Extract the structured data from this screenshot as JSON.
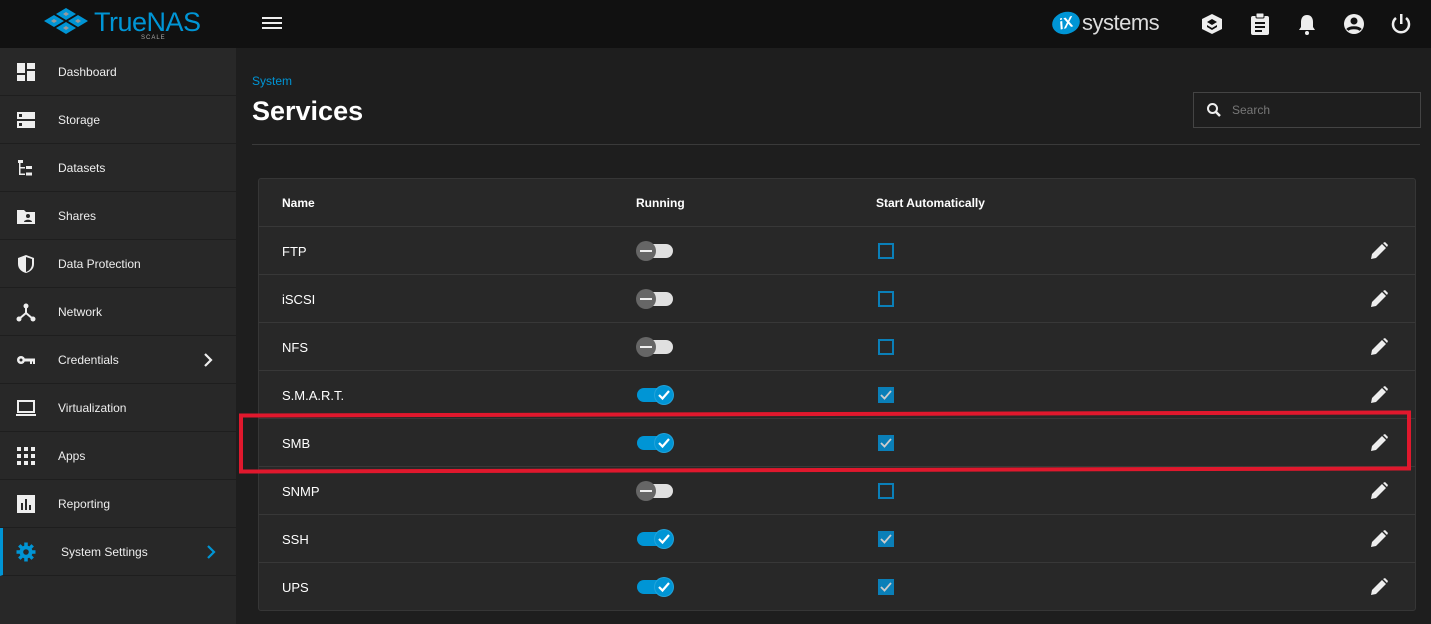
{
  "app": {
    "brand": "TrueNAS",
    "brand_sub": "SCALE",
    "vendor": "systems",
    "vendor_mark": "iX"
  },
  "topbar": {
    "icons": [
      "truecommand-icon",
      "clipboard-icon",
      "bell-icon",
      "account-icon",
      "power-icon"
    ]
  },
  "sidebar": {
    "items": [
      {
        "label": "Dashboard",
        "icon": "dashboard-icon"
      },
      {
        "label": "Storage",
        "icon": "storage-icon"
      },
      {
        "label": "Datasets",
        "icon": "datasets-icon"
      },
      {
        "label": "Shares",
        "icon": "shares-icon"
      },
      {
        "label": "Data Protection",
        "icon": "shield-icon"
      },
      {
        "label": "Network",
        "icon": "network-icon"
      },
      {
        "label": "Credentials",
        "icon": "key-icon",
        "chevron": true
      },
      {
        "label": "Virtualization",
        "icon": "laptop-icon"
      },
      {
        "label": "Apps",
        "icon": "apps-icon"
      },
      {
        "label": "Reporting",
        "icon": "chart-icon"
      },
      {
        "label": "System Settings",
        "icon": "gear-icon",
        "chevron": true,
        "active": true
      }
    ]
  },
  "page": {
    "breadcrumb": "System",
    "title": "Services",
    "search_placeholder": "Search"
  },
  "table": {
    "headers": {
      "name": "Name",
      "running": "Running",
      "auto": "Start Automatically"
    },
    "rows": [
      {
        "name": "FTP",
        "running": false,
        "auto": false
      },
      {
        "name": "iSCSI",
        "running": false,
        "auto": false
      },
      {
        "name": "NFS",
        "running": false,
        "auto": false
      },
      {
        "name": "S.M.A.R.T.",
        "running": true,
        "auto": true
      },
      {
        "name": "SMB",
        "running": true,
        "auto": true,
        "highlighted": true
      },
      {
        "name": "SNMP",
        "running": false,
        "auto": false
      },
      {
        "name": "SSH",
        "running": true,
        "auto": true
      },
      {
        "name": "UPS",
        "running": true,
        "auto": true
      }
    ]
  },
  "colors": {
    "accent": "#0095d5",
    "highlight": "#e0182d"
  }
}
